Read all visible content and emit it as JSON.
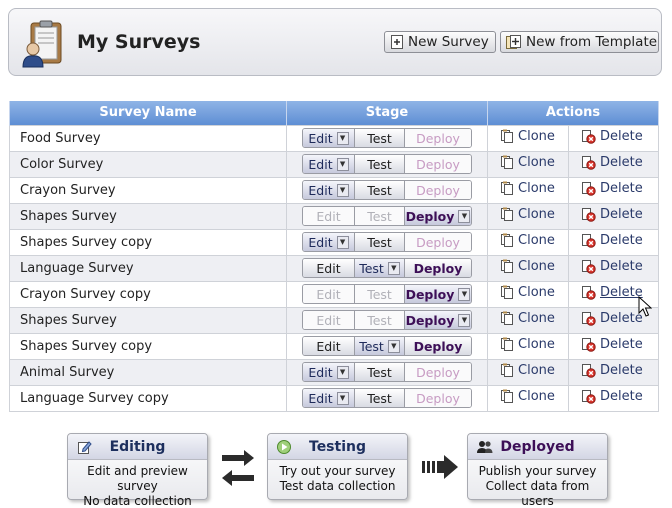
{
  "header": {
    "title": "My Surveys",
    "new_survey_label": "New Survey",
    "new_from_template_label": "New from Template"
  },
  "table": {
    "columns": [
      "Survey Name",
      "Stage",
      "Actions"
    ],
    "rows": [
      {
        "name": "Food Survey",
        "stage": "edit"
      },
      {
        "name": "Color Survey",
        "stage": "edit"
      },
      {
        "name": "Crayon Survey",
        "stage": "edit"
      },
      {
        "name": "Shapes Survey",
        "stage": "deploy"
      },
      {
        "name": "Shapes Survey copy",
        "stage": "edit"
      },
      {
        "name": "Language Survey",
        "stage": "test"
      },
      {
        "name": "Crayon Survey copy",
        "stage": "deploy"
      },
      {
        "name": "Shapes Survey",
        "stage": "deploy"
      },
      {
        "name": "Shapes Survey copy",
        "stage": "test"
      },
      {
        "name": "Animal Survey",
        "stage": "edit"
      },
      {
        "name": "Language Survey copy",
        "stage": "edit"
      }
    ],
    "stage_labels": {
      "edit": "Edit",
      "test": "Test",
      "deploy": "Deploy"
    },
    "clone_label": "Clone",
    "delete_label": "Delete"
  },
  "workflow": {
    "editing": {
      "title": "Editing",
      "line1": "Edit and preview survey",
      "line2": "No data collection"
    },
    "testing": {
      "title": "Testing",
      "line1": "Try out your survey",
      "line2": "Test data collection"
    },
    "deployed": {
      "title": "Deployed",
      "line1": "Publish your survey",
      "line2": "Collect data from users"
    }
  },
  "colors": {
    "header_blue": "#5e8ed4",
    "deploy_purple": "#3d0f57",
    "link_blue": "#2a3a6a"
  }
}
